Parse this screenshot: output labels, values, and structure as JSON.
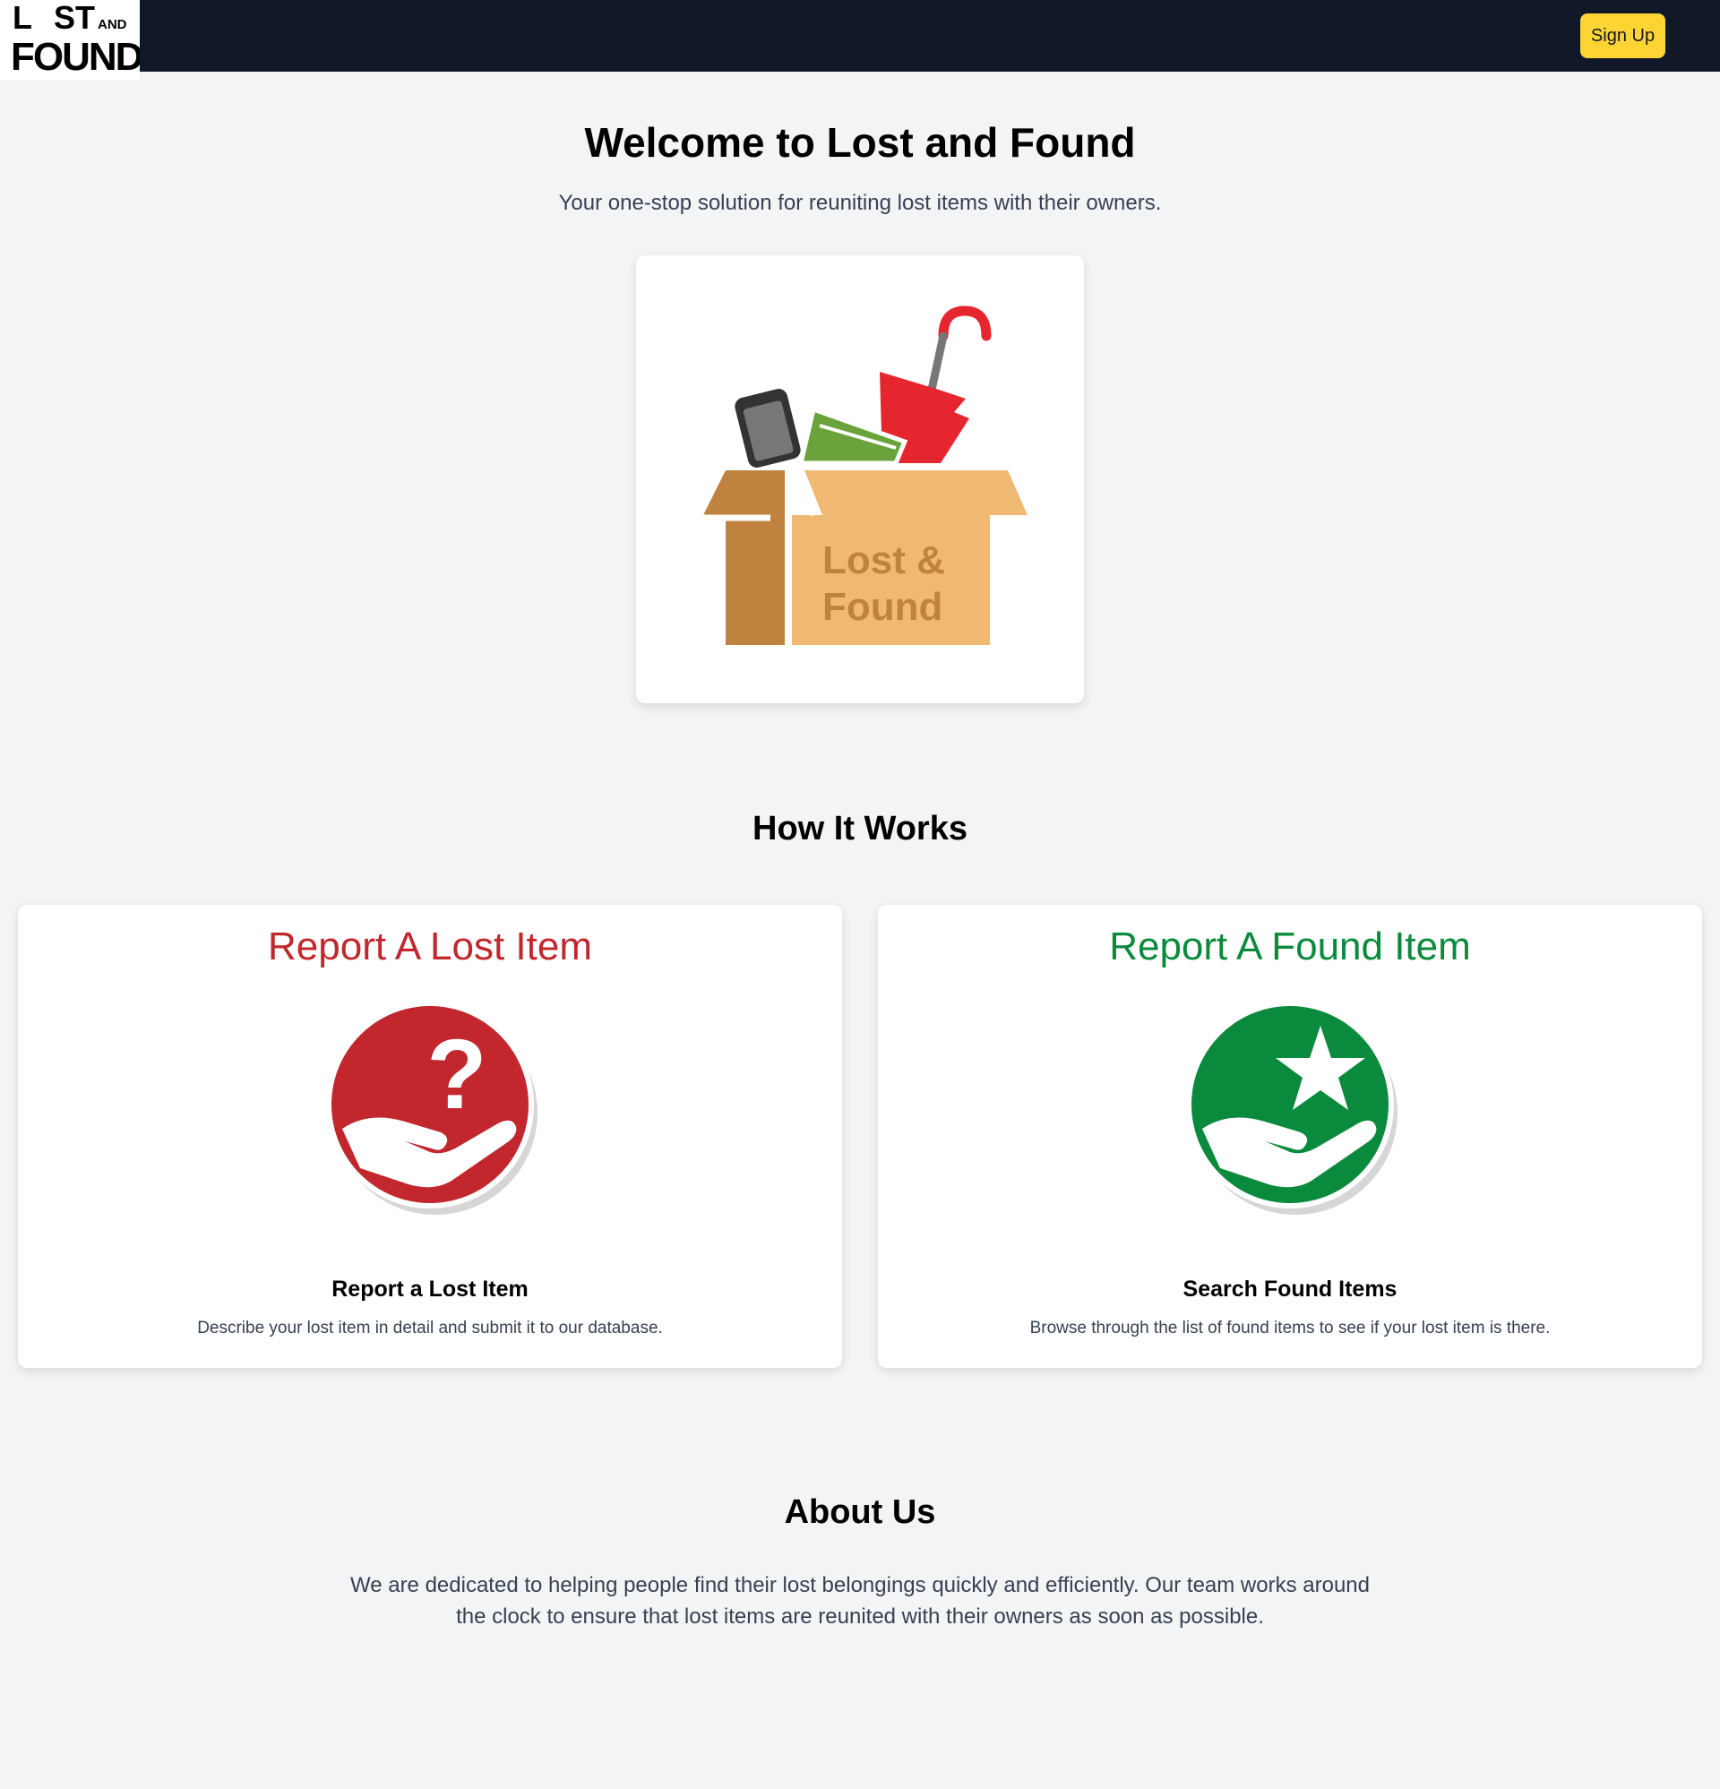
{
  "nav": {
    "logo_text": "LOST AND FOUND",
    "signup_label": "Sign Up",
    "background": "#111827",
    "button_color": "#fcd535"
  },
  "hero": {
    "title": "Welcome to Lost and Found",
    "subtitle": "Your one-stop solution for reuniting lost items with their owners.",
    "image_text_line1": "Lost &",
    "image_text_line2": "Found"
  },
  "how_it_works": {
    "title": "How It Works",
    "cards": [
      {
        "graphic_title": "Report A Lost Item",
        "heading": "Report a Lost Item",
        "description": "Describe your lost item in detail and submit it to our database.",
        "icon": "question-hand-icon",
        "color": "#c1272d"
      },
      {
        "graphic_title": "Report A Found Item",
        "heading": "Search Found Items",
        "description": "Browse through the list of found items to see if your lost item is there.",
        "icon": "star-hand-icon",
        "color": "#0a8a3c"
      }
    ]
  },
  "about": {
    "title": "About Us",
    "text": "We are dedicated to helping people find their lost belongings quickly and efficiently. Our team works around the clock to ensure that lost items are reunited with their owners as soon as possible."
  }
}
